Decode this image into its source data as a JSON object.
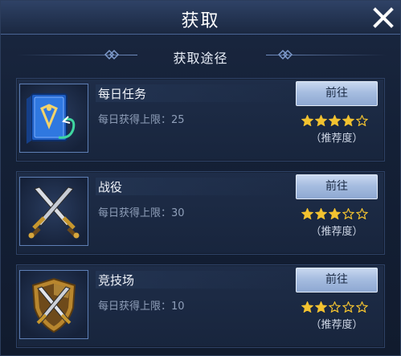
{
  "dialog": {
    "title": "获取",
    "subtitle": "获取途径"
  },
  "sources": [
    {
      "name": "每日任务",
      "limit_text": "每日获得上限：25",
      "go_label": "前往",
      "rating": 4,
      "rating_max": 5,
      "rating_label": "（推荐度）",
      "icon": "quest-book-icon"
    },
    {
      "name": "战役",
      "limit_text": "每日获得上限：30",
      "go_label": "前往",
      "rating": 3,
      "rating_max": 5,
      "rating_label": "（推荐度）",
      "icon": "crossed-swords-icon"
    },
    {
      "name": "竞技场",
      "limit_text": "每日获得上限：10",
      "go_label": "前往",
      "rating": 2,
      "rating_max": 5,
      "rating_label": "（推荐度）",
      "icon": "shield-swords-icon"
    }
  ],
  "colors": {
    "star_filled": "#f2c230",
    "star_empty": "#f2c230",
    "button": "#a6bde0"
  }
}
